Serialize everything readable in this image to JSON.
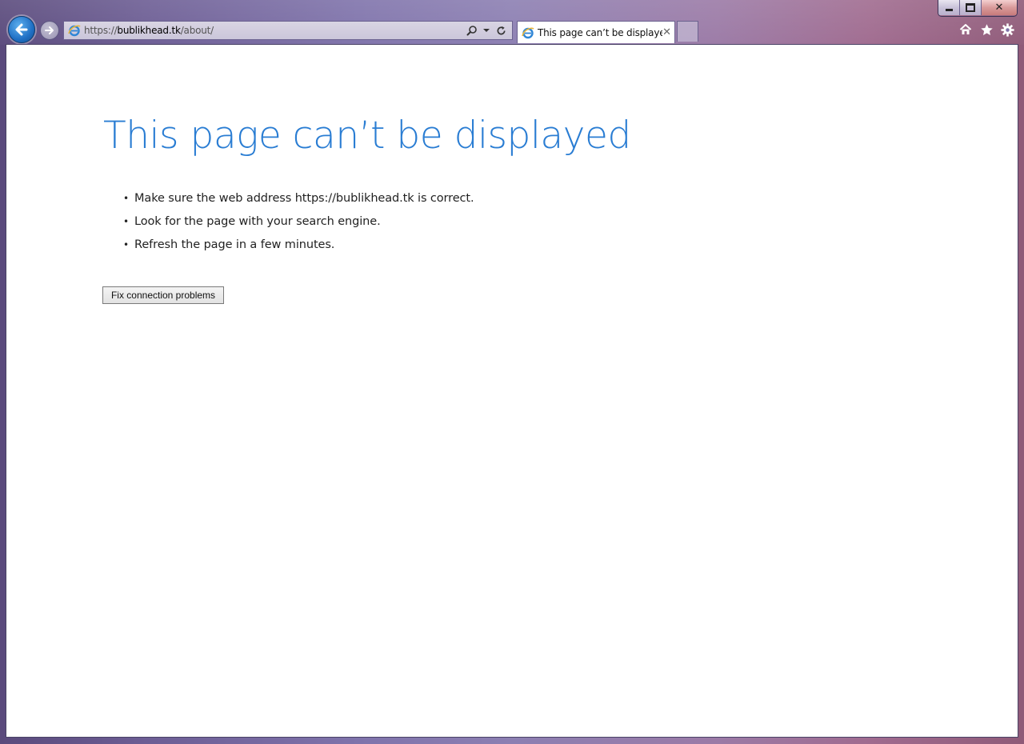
{
  "window": {
    "minimize_icon": "minimize-icon",
    "maximize_icon": "maximize-icon",
    "close_icon": "close-icon",
    "close_glyph": "✕"
  },
  "nav": {
    "back_icon": "back-arrow-icon",
    "forward_icon": "forward-arrow-icon"
  },
  "address": {
    "scheme": "https://",
    "domain": "bublikhead.tk",
    "path": "/about/"
  },
  "tab": {
    "title": "This page can’t be displayed",
    "close_glyph": "✕"
  },
  "toolbar": {
    "home_icon": "home-icon",
    "favorites_icon": "star-icon",
    "tools_icon": "gear-icon"
  },
  "page": {
    "heading": "This page can’t be displayed",
    "tips": [
      "Make sure the web address https://bublikhead.tk is correct.",
      "Look for the page with your search engine.",
      "Refresh the page in a few minutes."
    ],
    "fix_button": "Fix connection problems"
  },
  "colors": {
    "heading_blue": "#2a7dd3",
    "back_button_blue": "#1f6fc4"
  }
}
